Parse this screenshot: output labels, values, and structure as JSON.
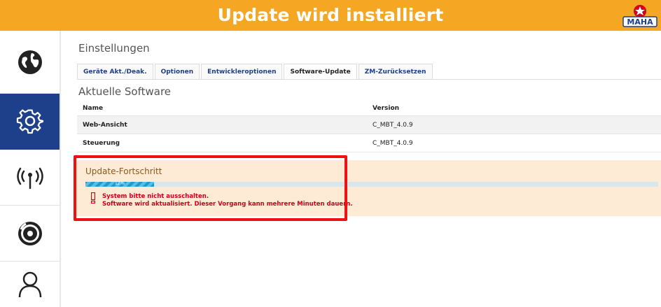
{
  "header": {
    "title": "Update wird installiert",
    "logo_text": "MAHA",
    "color": "#f5a623"
  },
  "sidebar": {
    "items": [
      {
        "icon": "globe-icon",
        "active": false
      },
      {
        "icon": "gear-icon",
        "active": true
      },
      {
        "icon": "antenna-icon",
        "active": false
      },
      {
        "icon": "brake-disc-icon",
        "active": false
      },
      {
        "icon": "user-icon",
        "active": false
      }
    ],
    "active_color": "#1e3f8a"
  },
  "settings": {
    "title": "Einstellungen",
    "tabs": [
      {
        "label": "Geräte Akt./Deak."
      },
      {
        "label": "Optionen"
      },
      {
        "label": "Entwickleroptionen"
      },
      {
        "label": "Software-Update",
        "active": true
      },
      {
        "label": "ZM-Zurücksetzen"
      }
    ]
  },
  "software": {
    "title": "Aktuelle Software",
    "columns": {
      "name": "Name",
      "version": "Version"
    },
    "rows": [
      {
        "name": "Web-Ansicht",
        "version": "C_MBT_4.0.9"
      },
      {
        "name": "Steuerung",
        "version": "C_MBT_4.0.9"
      }
    ]
  },
  "update": {
    "title": "Update-Fortschritt",
    "progress_percent": 12,
    "progress_label": "12 %",
    "warnings": [
      "System bitte nicht ausschalten.",
      "Software wird aktualisiert. Dieser Vorgang kann mehrere Minuten dauern."
    ],
    "warning_color": "#d0011b"
  }
}
